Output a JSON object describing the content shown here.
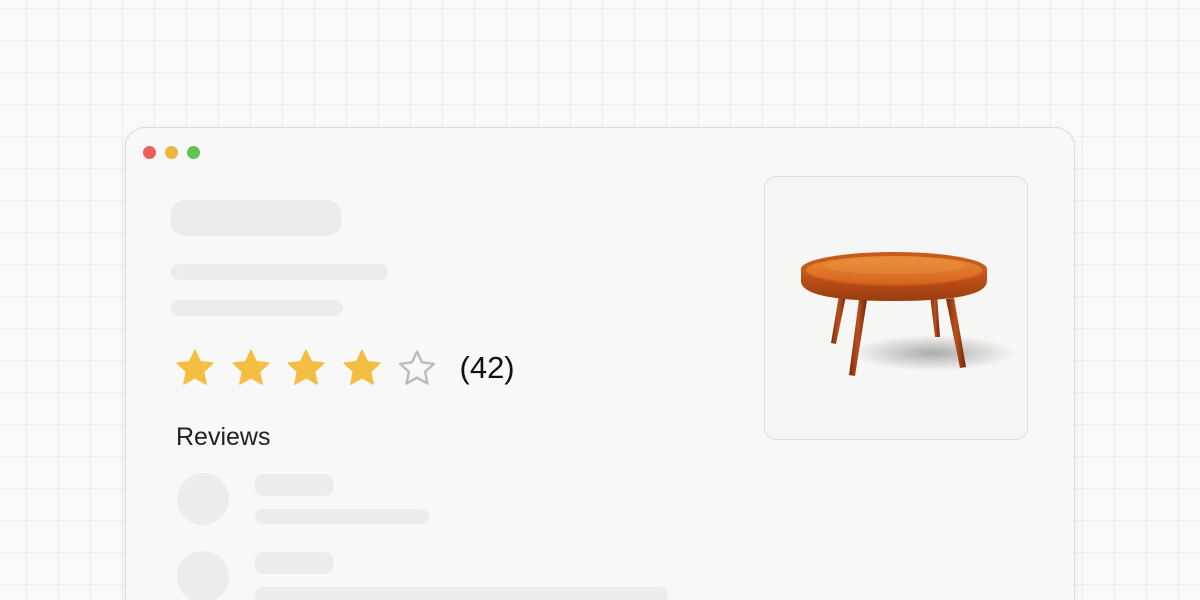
{
  "window": {
    "controls": [
      "close",
      "minimize",
      "maximize"
    ]
  },
  "product": {
    "rating": {
      "stars_filled": 4,
      "stars_total": 5,
      "count_label": "(42)"
    },
    "image": {
      "subject": "round-wooden-coffee-table-icon"
    }
  },
  "reviews": {
    "heading": "Reviews",
    "items_shown": 2
  },
  "colors": {
    "star_filled": "#f4be42",
    "star_empty": "#bcbcbc",
    "skeleton": "#ececec",
    "window_bg": "#f8f8f8",
    "close": "#ec5f57",
    "minimize": "#f1b43b",
    "maximize": "#5fc454",
    "table_wood": "#d9662a"
  }
}
